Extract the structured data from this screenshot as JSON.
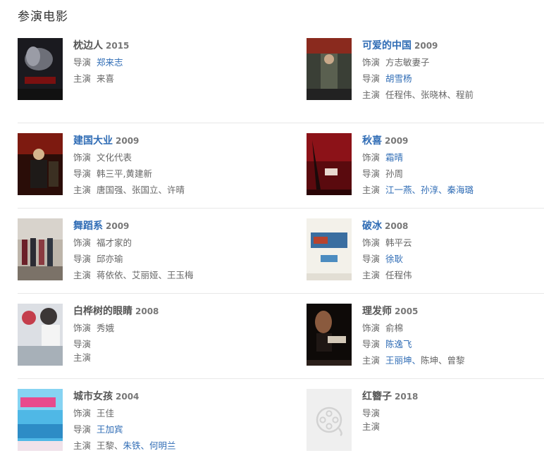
{
  "section_title": "参演电影",
  "labels": {
    "role": "饰演",
    "director": "导演",
    "cast": "主演"
  },
  "colors": {
    "link": "#2f6cb5",
    "text": "#666666",
    "divider": "#e8e8e8"
  },
  "movies": [
    {
      "title": "枕边人",
      "year": "2015",
      "title_link": false,
      "director": [
        {
          "name": "郑来志",
          "link": true
        }
      ],
      "cast": [
        {
          "name": "来喜",
          "link": false
        }
      ]
    },
    {
      "title": "可爱的中国",
      "year": "2009",
      "title_link": true,
      "role": "方志敏妻子",
      "director": [
        {
          "name": "胡雪杨",
          "link": true
        }
      ],
      "cast": [
        {
          "name": "任程伟、张晓林、程前",
          "link": false
        }
      ]
    },
    {
      "title": "建国大业",
      "year": "2009",
      "title_link": true,
      "role": "文化代表",
      "director": [
        {
          "name": "韩三平,黄建新",
          "link": false
        }
      ],
      "cast": [
        {
          "name": "唐国强、张国立、许晴",
          "link": false
        }
      ]
    },
    {
      "title": "秋喜",
      "year": "2009",
      "title_link": true,
      "role": "霜晴",
      "role_link": true,
      "director": [
        {
          "name": "孙周",
          "link": false
        }
      ],
      "cast": [
        {
          "name": "江一燕、",
          "link": true
        },
        {
          "name": "孙淳、",
          "link": true
        },
        {
          "name": "秦海璐",
          "link": true
        }
      ]
    },
    {
      "title": "舞蹈系",
      "year": "2009",
      "title_link": true,
      "role": "福才家的",
      "director": [
        {
          "name": "邱亦瑜",
          "link": false
        }
      ],
      "cast": [
        {
          "name": "蒋依依、艾丽娅、王玉梅",
          "link": false
        }
      ]
    },
    {
      "title": "破冰",
      "year": "2008",
      "title_link": true,
      "role": "韩平云",
      "director": [
        {
          "name": "徐耿",
          "link": true
        }
      ],
      "cast": [
        {
          "name": "任程伟",
          "link": false
        }
      ]
    },
    {
      "title": "白桦树的眼睛",
      "year": "2008",
      "title_link": false,
      "role": "秀娥",
      "director": [],
      "cast": []
    },
    {
      "title": "理发师",
      "year": "2005",
      "title_link": false,
      "role": "俞棉",
      "director": [
        {
          "name": "陈逸飞",
          "link": true
        }
      ],
      "cast": [
        {
          "name": "王丽坤、",
          "link": true
        },
        {
          "name": "陈坤、曾黎",
          "link": false
        }
      ]
    },
    {
      "title": "城市女孩",
      "year": "2004",
      "title_link": false,
      "role": "王佳",
      "director": [
        {
          "name": "王加宾",
          "link": true
        }
      ],
      "cast": [
        {
          "name": "王黎、",
          "link": false
        },
        {
          "name": "朱铁、",
          "link": true
        },
        {
          "name": "何明兰",
          "link": true
        }
      ]
    },
    {
      "title": "红簪子",
      "year": "2018",
      "title_link": false,
      "director": [],
      "cast": []
    }
  ]
}
